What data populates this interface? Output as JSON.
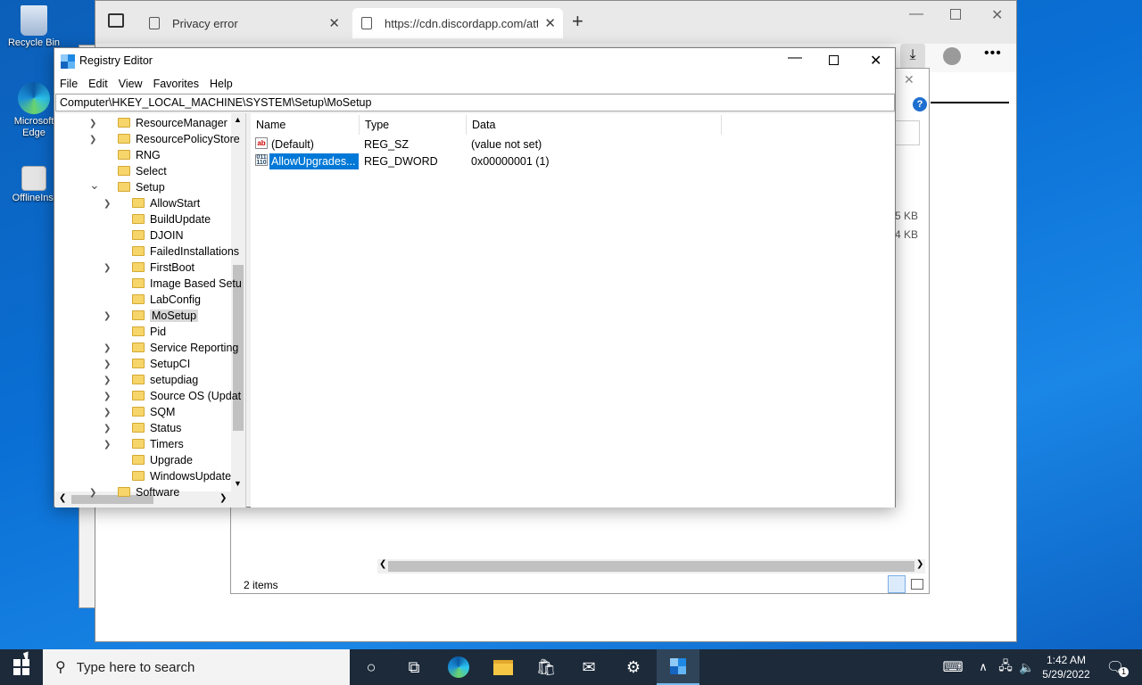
{
  "desktop": {
    "icons": [
      {
        "label": "Recycle Bin",
        "icon": "recycle-bin-icon"
      },
      {
        "label": "Microsoft Edge",
        "icon": "edge-icon"
      },
      {
        "label": "OfflineInsi",
        "icon": "offline-insider-icon"
      }
    ]
  },
  "browser": {
    "tabs": [
      {
        "label": "Privacy error"
      },
      {
        "label": "https://cdn.discordapp.com/atta"
      }
    ],
    "new_tab": "+"
  },
  "explorer": {
    "sizes": [
      "5 KB",
      "4 KB"
    ],
    "status": "2 items"
  },
  "regedit": {
    "title": "Registry Editor",
    "menu": [
      "File",
      "Edit",
      "View",
      "Favorites",
      "Help"
    ],
    "address": "Computer\\HKEY_LOCAL_MACHINE\\SYSTEM\\Setup\\MoSetup",
    "tree": [
      {
        "label": "ResourceManager",
        "level": 1,
        "expander": "collapsed"
      },
      {
        "label": "ResourcePolicyStore",
        "level": 1,
        "expander": "collapsed"
      },
      {
        "label": "RNG",
        "level": 1,
        "expander": "none"
      },
      {
        "label": "Select",
        "level": 1,
        "expander": "none"
      },
      {
        "label": "Setup",
        "level": 1,
        "expander": "expanded"
      },
      {
        "label": "AllowStart",
        "level": 2,
        "expander": "collapsed"
      },
      {
        "label": "BuildUpdate",
        "level": 2,
        "expander": "none"
      },
      {
        "label": "DJOIN",
        "level": 2,
        "expander": "none"
      },
      {
        "label": "FailedInstallations",
        "level": 2,
        "expander": "none"
      },
      {
        "label": "FirstBoot",
        "level": 2,
        "expander": "collapsed"
      },
      {
        "label": "Image Based Setu",
        "level": 2,
        "expander": "none"
      },
      {
        "label": "LabConfig",
        "level": 2,
        "expander": "none"
      },
      {
        "label": "MoSetup",
        "level": 2,
        "expander": "collapsed",
        "selected": true
      },
      {
        "label": "Pid",
        "level": 2,
        "expander": "none"
      },
      {
        "label": "Service Reporting",
        "level": 2,
        "expander": "collapsed"
      },
      {
        "label": "SetupCI",
        "level": 2,
        "expander": "collapsed"
      },
      {
        "label": "setupdiag",
        "level": 2,
        "expander": "collapsed"
      },
      {
        "label": "Source OS (Updat",
        "level": 2,
        "expander": "collapsed"
      },
      {
        "label": "SQM",
        "level": 2,
        "expander": "collapsed"
      },
      {
        "label": "Status",
        "level": 2,
        "expander": "collapsed"
      },
      {
        "label": "Timers",
        "level": 2,
        "expander": "collapsed"
      },
      {
        "label": "Upgrade",
        "level": 2,
        "expander": "none"
      },
      {
        "label": "WindowsUpdate",
        "level": 2,
        "expander": "none"
      },
      {
        "label": "Software",
        "level": 1,
        "expander": "collapsed"
      }
    ],
    "columns": [
      "Name",
      "Type",
      "Data"
    ],
    "values": [
      {
        "name": "(Default)",
        "type": "REG_SZ",
        "data": "(value not set)",
        "icon": "string-value-icon"
      },
      {
        "name": "AllowUpgrades...",
        "type": "REG_DWORD",
        "data": "0x00000001 (1)",
        "icon": "binary-value-icon",
        "selected": true
      }
    ]
  },
  "taskbar": {
    "search_placeholder": "Type here to search",
    "time": "1:42 AM",
    "date": "5/29/2022",
    "notification_count": "1"
  },
  "colors": {
    "selection": "#0078d7",
    "taskbar": "#1c2a3a",
    "accent": "#1f6fd0"
  }
}
